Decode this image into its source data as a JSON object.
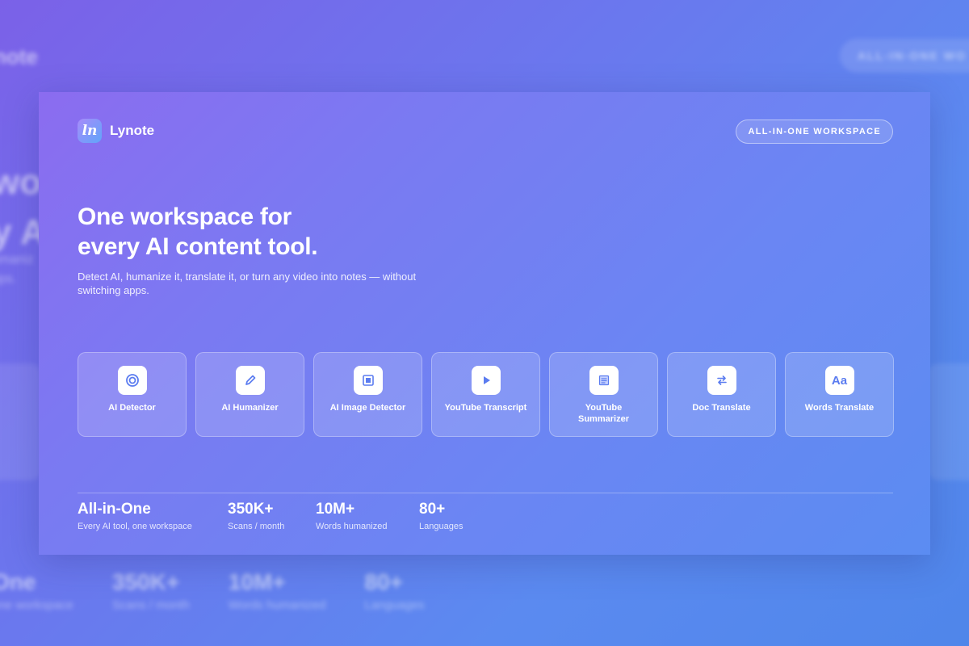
{
  "app": {
    "brand_name": "Lynote",
    "logo_glyph": "ln",
    "tag_pill": "ALL-IN-ONE WORKSPACE"
  },
  "hero": {
    "headline_line1": "One workspace for",
    "headline_line2": "every AI content tool.",
    "subtext": "Detect AI, humanize it, translate it, or turn any video into notes — without switching apps."
  },
  "tools": [
    {
      "label": "AI Detector",
      "icon": "target-icon"
    },
    {
      "label": "AI Humanizer",
      "icon": "pen-icon"
    },
    {
      "label": "AI Image Detector",
      "icon": "image-frame-icon"
    },
    {
      "label": "YouTube Transcript",
      "icon": "play-icon"
    },
    {
      "label": "YouTube Summarizer",
      "icon": "document-lines-icon"
    },
    {
      "label": "Doc Translate",
      "icon": "swap-arrows-icon"
    },
    {
      "label": "Words Translate",
      "icon": "font-aa-icon",
      "glyph": "Aa"
    }
  ],
  "stats": [
    {
      "value": "All-in-One",
      "label": "Every AI tool, one workspace"
    },
    {
      "value": "350K+",
      "label": "Scans / month"
    },
    {
      "value": "10M+",
      "label": "Words humanized"
    },
    {
      "value": "80+",
      "label": "Languages"
    }
  ],
  "background": {
    "brand_fragment": "note",
    "pill_fragment": "ALL-IN-ONE WO",
    "headline_fragment_1": "wo",
    "headline_fragment_2": "y A",
    "subtext_fragment_1": "umaniz",
    "subtext_fragment_2": "pps.",
    "stats": [
      {
        "value": "One",
        "label": "one workspace"
      },
      {
        "value": "350K+",
        "label": "Scans / month"
      },
      {
        "value": "10M+",
        "label": "Words humanized"
      },
      {
        "value": "80+",
        "label": "Languages"
      }
    ]
  },
  "colors": {
    "accent_icon": "#5b7cf0",
    "gradient_start": "#8b6cf0",
    "gradient_end": "#5b8cf2"
  }
}
